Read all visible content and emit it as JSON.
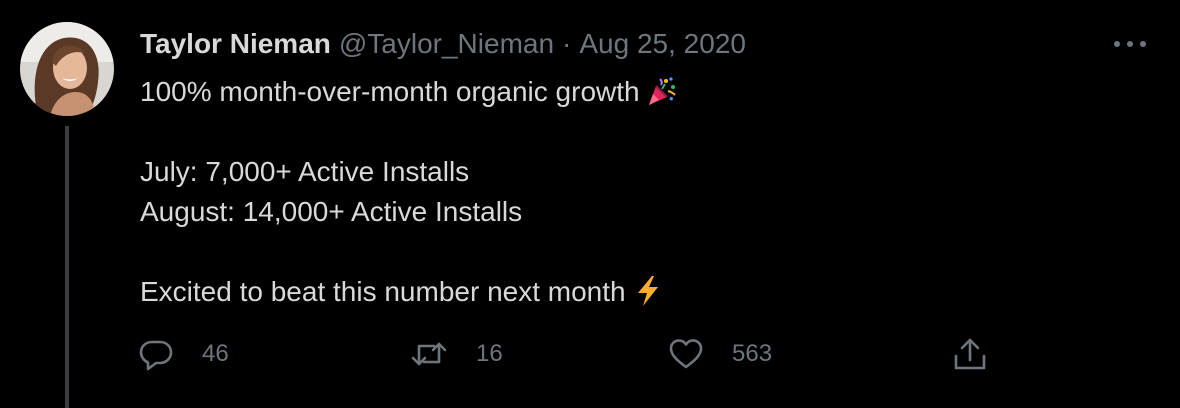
{
  "author": {
    "name": "Taylor Nieman",
    "handle": "@Taylor_Nieman",
    "separator": "·",
    "date": "Aug 25, 2020"
  },
  "tweet": {
    "lines": [
      "100% month-over-month organic growth",
      "",
      "July: 7,000+ Active Installs",
      "August: 14,000+ Active Installs",
      "",
      "Excited to beat this number next month"
    ],
    "emojis": {
      "line1": "party-popper-icon",
      "line6": "lightning-bolt-icon"
    }
  },
  "actions": {
    "replies": "46",
    "retweets": "16",
    "likes": "563"
  },
  "icons": {
    "more": "more-horizontal-icon",
    "reply": "reply-bubble-icon",
    "retweet": "retweet-icon",
    "like": "heart-icon",
    "share": "share-icon"
  },
  "colors": {
    "background": "#000000",
    "text": "#d9d9d9",
    "muted": "#6e767d",
    "thread_line": "#3a3d40"
  }
}
